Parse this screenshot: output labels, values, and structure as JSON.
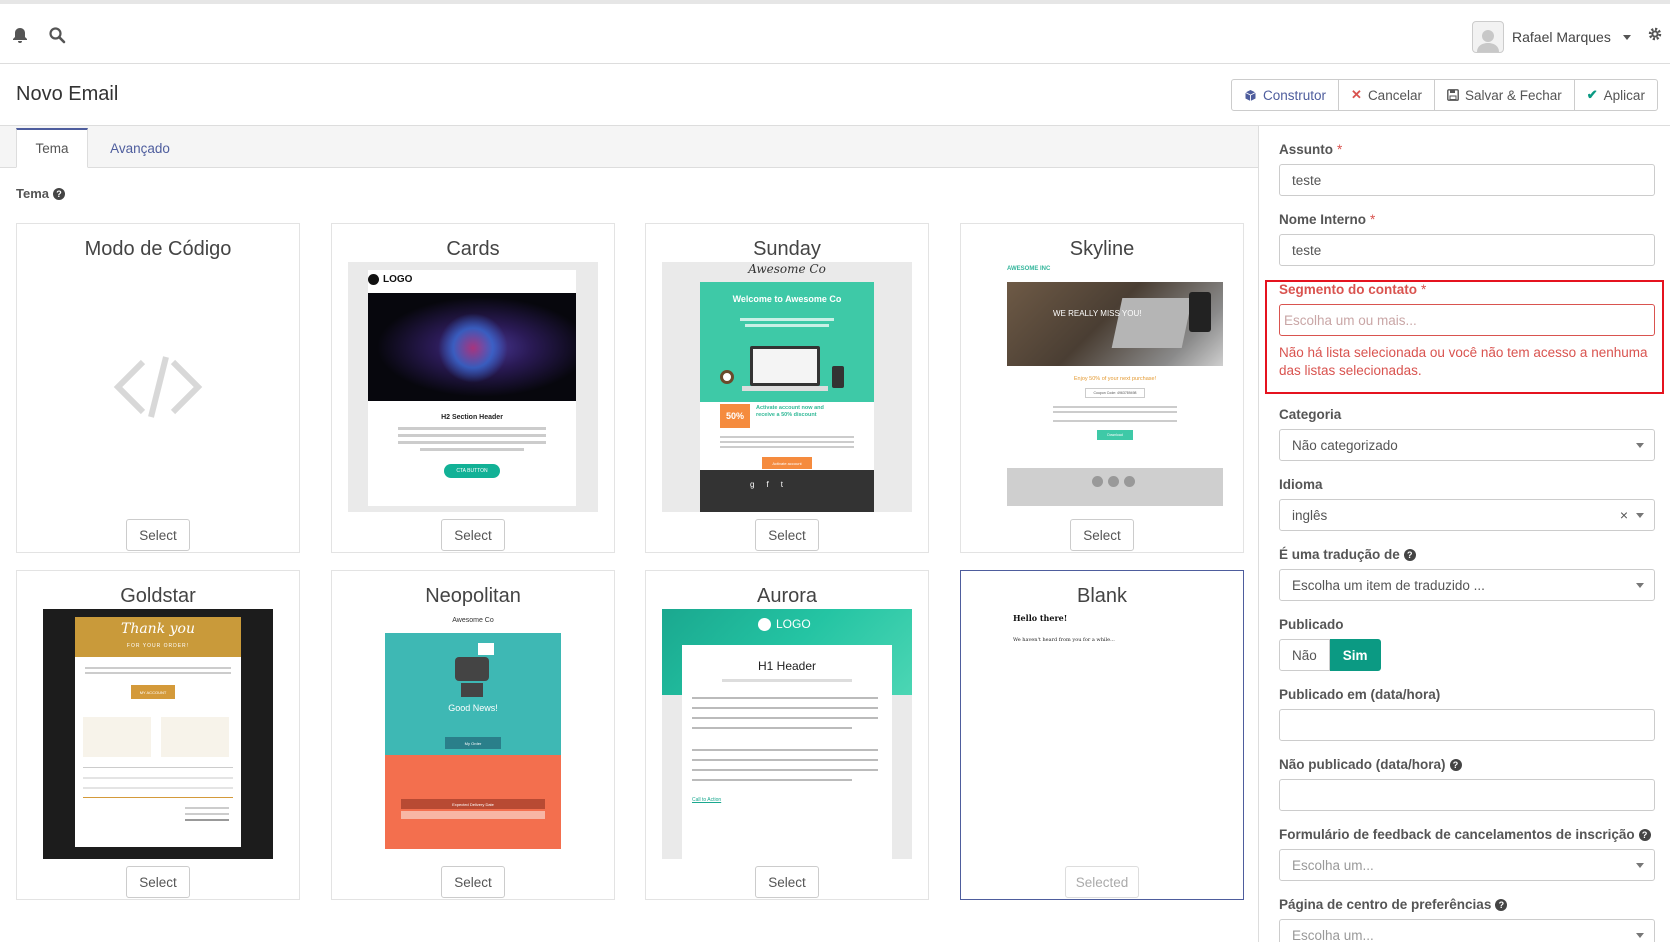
{
  "topbar": {
    "user_name": "Rafael Marques"
  },
  "header": {
    "title": "Novo Email",
    "buttons": {
      "builder": "Construtor",
      "cancel": "Cancelar",
      "save_close": "Salvar & Fechar",
      "apply": "Aplicar"
    }
  },
  "tabs": {
    "theme": "Tema",
    "advanced": "Avançado"
  },
  "theme_section_label": "Tema",
  "themes": [
    {
      "name": "Modo de Código",
      "button": "Select"
    },
    {
      "name": "Cards",
      "button": "Select"
    },
    {
      "name": "Sunday",
      "button": "Select"
    },
    {
      "name": "Skyline",
      "button": "Select"
    },
    {
      "name": "Goldstar",
      "button": "Select"
    },
    {
      "name": "Neopolitan",
      "button": "Select"
    },
    {
      "name": "Aurora",
      "button": "Select"
    },
    {
      "name": "Blank",
      "button": "Selected"
    }
  ],
  "thumbs": {
    "cards": {
      "logo": "LOGO",
      "heading": "H2 Section Header",
      "cta": "CTA BUTTON"
    },
    "sunday": {
      "brand": "Awesome Co",
      "welcome": "Welcome to Awesome Co",
      "badge": "50%",
      "offer": "Activate account now and receive a 50% discount",
      "action": "Activate account"
    },
    "skyline": {
      "brand": "AWESOME INC",
      "banner": "WE REALLY MISS YOU!",
      "offer": "Enjoy 50% of your next purchase!",
      "coupon": "Coupon Code: 4963789498",
      "cta": "Download"
    },
    "goldstar": {
      "thanks": "Thank you",
      "sub": "FOR YOUR ORDER!",
      "btn": "MY ACCOUNT"
    },
    "neopolitan": {
      "brand": "Awesome Co",
      "news": "Good News!",
      "btn": "My Order",
      "delivery": "Expected Delivery Date"
    },
    "aurora": {
      "logo": "LOGO",
      "heading": "H1 Header",
      "cta": "Call to Action"
    },
    "blank": {
      "greeting": "Hello there!",
      "body": "We haven't heard from you for a while..."
    }
  },
  "form": {
    "subject": {
      "label": "Assunto",
      "value": "teste"
    },
    "internal_name": {
      "label": "Nome Interno",
      "value": "teste"
    },
    "segment": {
      "label": "Segmento do contato",
      "placeholder": "Escolha um ou mais...",
      "error": "Não há lista selecionada ou você não tem acesso a nenhuma das listas selecionadas."
    },
    "category": {
      "label": "Categoria",
      "value": "Não categorizado"
    },
    "language": {
      "label": "Idioma",
      "value": "inglês"
    },
    "translation_of": {
      "label": "É uma tradução de",
      "value": "Escolha um item de traduzido ..."
    },
    "published": {
      "label": "Publicado",
      "no": "Não",
      "yes": "Sim"
    },
    "publish_up": {
      "label": "Publicado em (data/hora)",
      "value": ""
    },
    "publish_down": {
      "label": "Não publicado (data/hora)",
      "value": ""
    },
    "unsubscribe_form": {
      "label": "Formulário de feedback de cancelamentos de inscrição",
      "value": "Escolha um..."
    },
    "preference_center": {
      "label": "Página de centro de preferências",
      "value": "Escolha um..."
    }
  },
  "colors": {
    "accent": "#4e5d9d",
    "success": "#0b9a83",
    "error": "#d9534f"
  }
}
